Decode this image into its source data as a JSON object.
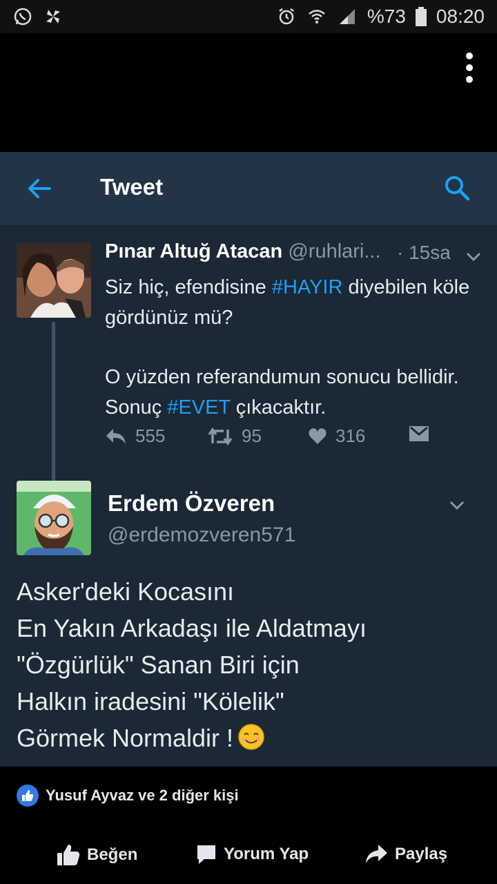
{
  "status_bar": {
    "battery": "%73",
    "time": "08:20"
  },
  "header": {
    "title": "Tweet"
  },
  "tweet1": {
    "name": "Pınar Altuğ Atacan",
    "handle": "@ruhlari...",
    "time": "· 15sa",
    "text1_a": "Siz hiç, efendisine ",
    "text1_hash": "#HAYIR",
    "text1_b": " diyebilen köle gördünüz mü?",
    "text2_a": "O yüzden referandumun sonucu bellidir. Sonuç ",
    "text2_hash": "#EVET",
    "text2_b": " çıkacaktır.",
    "replies": "555",
    "retweets": "95",
    "likes": "316"
  },
  "tweet2": {
    "name": "Erdem Özveren",
    "handle": "@erdemozveren571",
    "lines": [
      "Asker'deki Kocasını",
      "En Yakın Arkadaşı ile Aldatmayı",
      "\"Özgürlük\" Sanan Biri için",
      "Halkın iradesini \"Kölelik\"",
      "Görmek Normaldir !"
    ]
  },
  "facebook": {
    "reactions_text": "Yusuf Ayvaz ve 2 diğer kişi",
    "like_label": "Beğen",
    "comment_label": "Yorum Yap",
    "share_label": "Paylaş"
  },
  "colors": {
    "twitter_bg": "#1b2836",
    "twitter_header": "#243447",
    "accent": "#1da1f2",
    "fb_like": "#3578e5"
  },
  "icons": [
    "whatsapp-icon",
    "pinwheel-icon",
    "alarm-icon",
    "wifi-icon",
    "signal-icon",
    "battery-icon",
    "more-vert-icon",
    "back-arrow-icon",
    "search-icon",
    "chevron-down-icon",
    "reply-icon",
    "retweet-icon",
    "heart-icon",
    "message-icon",
    "thumbs-up-icon",
    "comment-icon",
    "share-icon",
    "smile-emoji-icon"
  ]
}
